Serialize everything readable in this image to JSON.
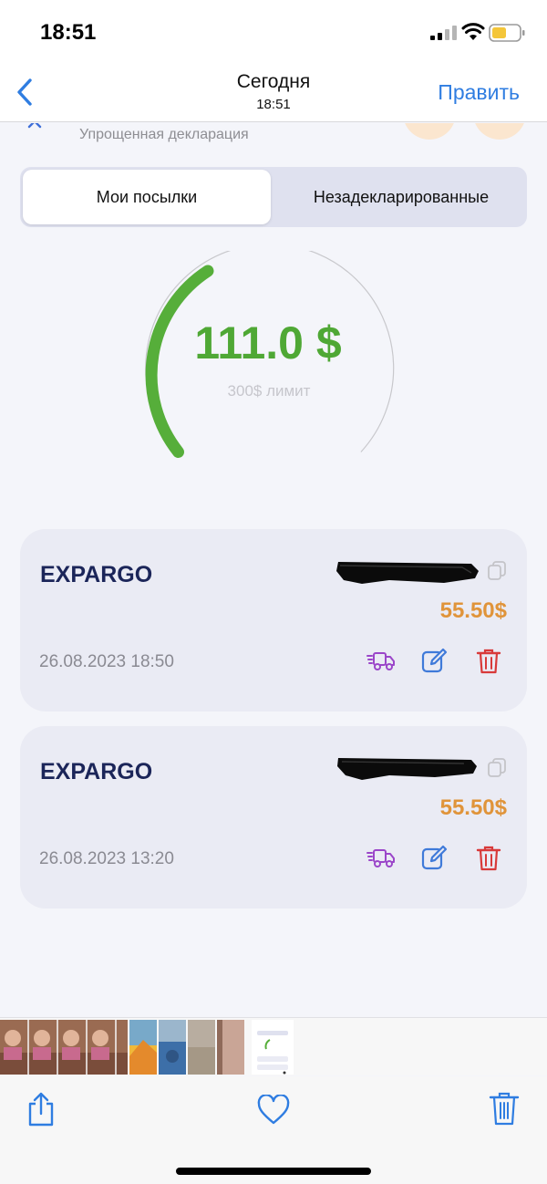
{
  "status_bar": {
    "time": "18:51"
  },
  "viewer_header": {
    "title": "Сегодня",
    "subtitle": "18:51",
    "edit_label": "Править"
  },
  "declaration": {
    "type_label": "Упрощенная декларация"
  },
  "tabs": [
    {
      "label": "Мои посылки",
      "active": true
    },
    {
      "label": "Незадекларированные",
      "active": false
    }
  ],
  "gauge": {
    "value_text": "111.0 $",
    "limit_text": "300$ лимит",
    "used": 111.0,
    "limit": 300
  },
  "parcels": [
    {
      "brand": "EXPARGO",
      "price": "55.50$",
      "date": "26.08.2023 18:50"
    },
    {
      "brand": "EXPARGO",
      "price": "55.50$",
      "date": "26.08.2023 13:20"
    }
  ],
  "colors": {
    "accent_blue": "#2f7de1",
    "gauge_green": "#4fa835",
    "price_orange": "#e0943a",
    "brand_navy": "#1b2559",
    "truck_purple": "#9b46c9",
    "edit_blue": "#3f7ad9",
    "trash_red": "#d83a3a"
  }
}
